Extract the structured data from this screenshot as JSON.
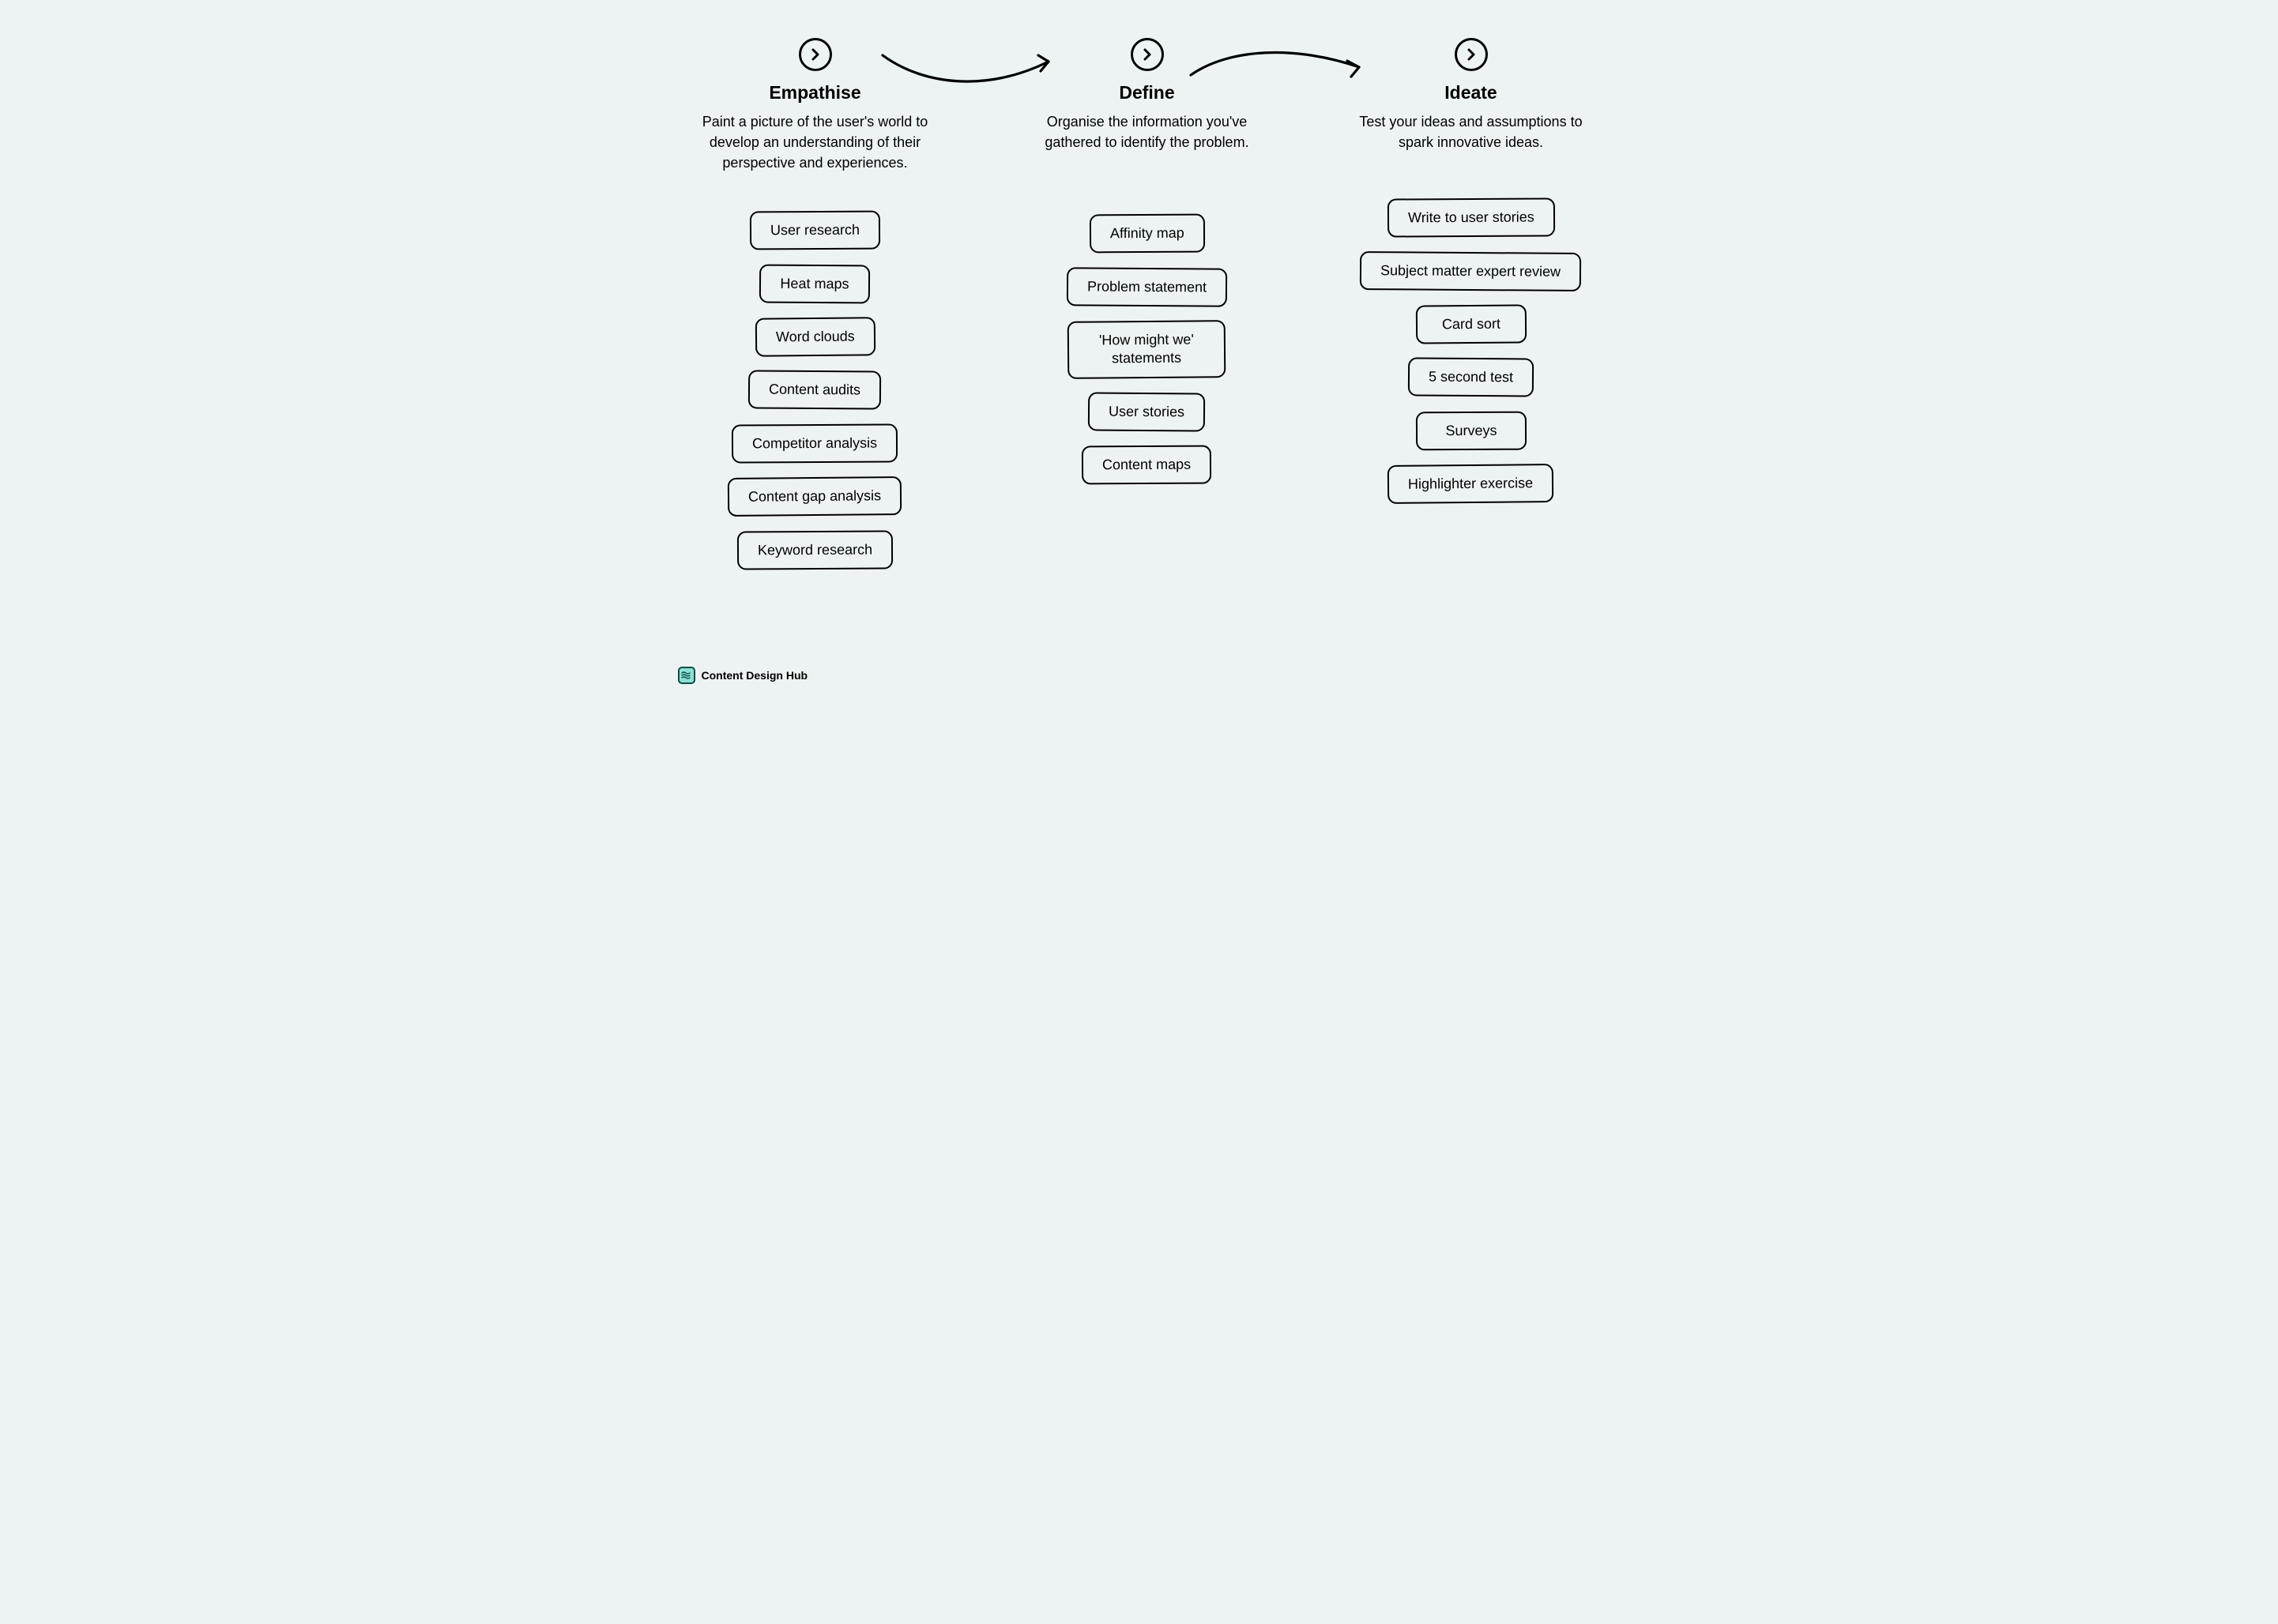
{
  "columns": [
    {
      "title": "Empathise",
      "description": "Paint a picture of the user's world to develop an understanding of their perspective and experiences.",
      "items": [
        "User research",
        "Heat maps",
        "Word clouds",
        "Content audits",
        "Competitor analysis",
        "Content gap analysis",
        "Keyword research"
      ]
    },
    {
      "title": "Define",
      "description": "Organise the information you've gathered to identify the problem.",
      "items": [
        "Affinity map",
        "Problem statement",
        "'How might we' statements",
        "User stories",
        "Content maps"
      ]
    },
    {
      "title": "Ideate",
      "description": "Test your ideas and assumptions to spark innovative ideas.",
      "items": [
        "Write to user stories",
        "Subject matter expert review",
        "Card sort",
        "5 second test",
        "Surveys",
        "Highlighter exercise"
      ]
    }
  ],
  "brand": {
    "label": "Content Design Hub"
  }
}
